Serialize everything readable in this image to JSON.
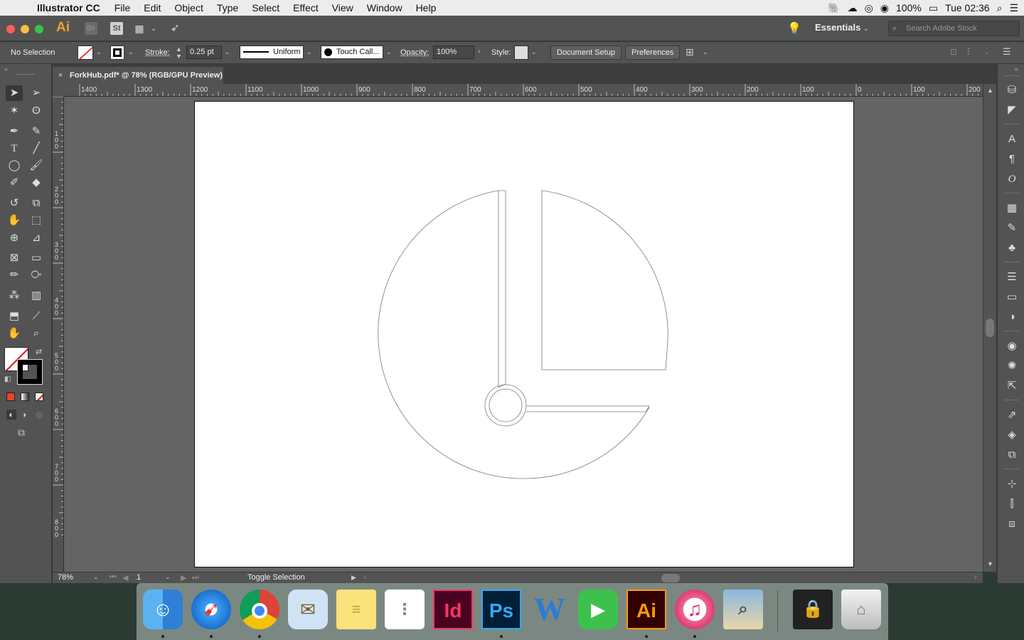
{
  "menubar": {
    "app_name": "Illustrator CC",
    "items": [
      "File",
      "Edit",
      "Object",
      "Type",
      "Select",
      "Effect",
      "View",
      "Window",
      "Help"
    ],
    "battery": "100%",
    "clock": "Tue 02:36"
  },
  "appbar": {
    "logo": "Ai",
    "bridge": "Br",
    "stock": "St",
    "workspace": "Essentials",
    "search_placeholder": "Search Adobe Stock"
  },
  "control": {
    "selection": "No Selection",
    "stroke_label": "Stroke:",
    "stroke_value": "0.25 pt",
    "profile": "Uniform",
    "brush": "Touch Call...",
    "opacity_label": "Opacity:",
    "opacity_value": "100%",
    "style_label": "Style:",
    "document_setup": "Document Setup",
    "preferences": "Preferences"
  },
  "document": {
    "tab_title": "ForkHub.pdf* @ 78% (RGB/GPU Preview)"
  },
  "ruler": {
    "h_ticks": [
      "1400",
      "1300",
      "1200",
      "1100",
      "1000",
      "900",
      "800",
      "700",
      "600",
      "500",
      "400",
      "300",
      "200",
      "100",
      "0",
      "100",
      "200"
    ],
    "v_ticks": [
      "100",
      "200",
      "300",
      "400",
      "500",
      "600",
      "700",
      "800"
    ]
  },
  "status": {
    "zoom": "78%",
    "page": "1",
    "mode": "Toggle Selection"
  },
  "tools": [
    "selection-tool",
    "direct-selection-tool",
    "magic-wand-tool",
    "lasso-tool",
    "pen-tool",
    "curvature-tool",
    "type-tool",
    "line-tool",
    "ellipse-tool",
    "paintbrush-tool",
    "shaper-tool",
    "eraser-tool",
    "rotate-tool",
    "scale-tool",
    "warp-tool",
    "free-transform-tool",
    "shape-builder-tool",
    "perspective-grid-tool",
    "mesh-tool",
    "gradient-tool",
    "eyedropper-tool",
    "blend-tool",
    "symbol-sprayer-tool",
    "column-graph-tool",
    "artboard-tool",
    "slice-tool",
    "hand-tool",
    "zoom-tool"
  ],
  "dock": [
    {
      "name": "Finder",
      "label": ""
    },
    {
      "name": "Safari",
      "label": ""
    },
    {
      "name": "Chrome",
      "label": ""
    },
    {
      "name": "Mail",
      "label": ""
    },
    {
      "name": "Notes",
      "label": ""
    },
    {
      "name": "Reminders",
      "label": ""
    },
    {
      "name": "InDesign",
      "label": "Id"
    },
    {
      "name": "Photoshop",
      "label": "Ps"
    },
    {
      "name": "Word",
      "label": "W"
    },
    {
      "name": "FaceTime",
      "label": ""
    },
    {
      "name": "Illustrator",
      "label": "Ai"
    },
    {
      "name": "iTunes",
      "label": "♫"
    },
    {
      "name": "Preview",
      "label": ""
    },
    {
      "name": "Keychain",
      "label": ""
    },
    {
      "name": "Trash",
      "label": ""
    }
  ]
}
